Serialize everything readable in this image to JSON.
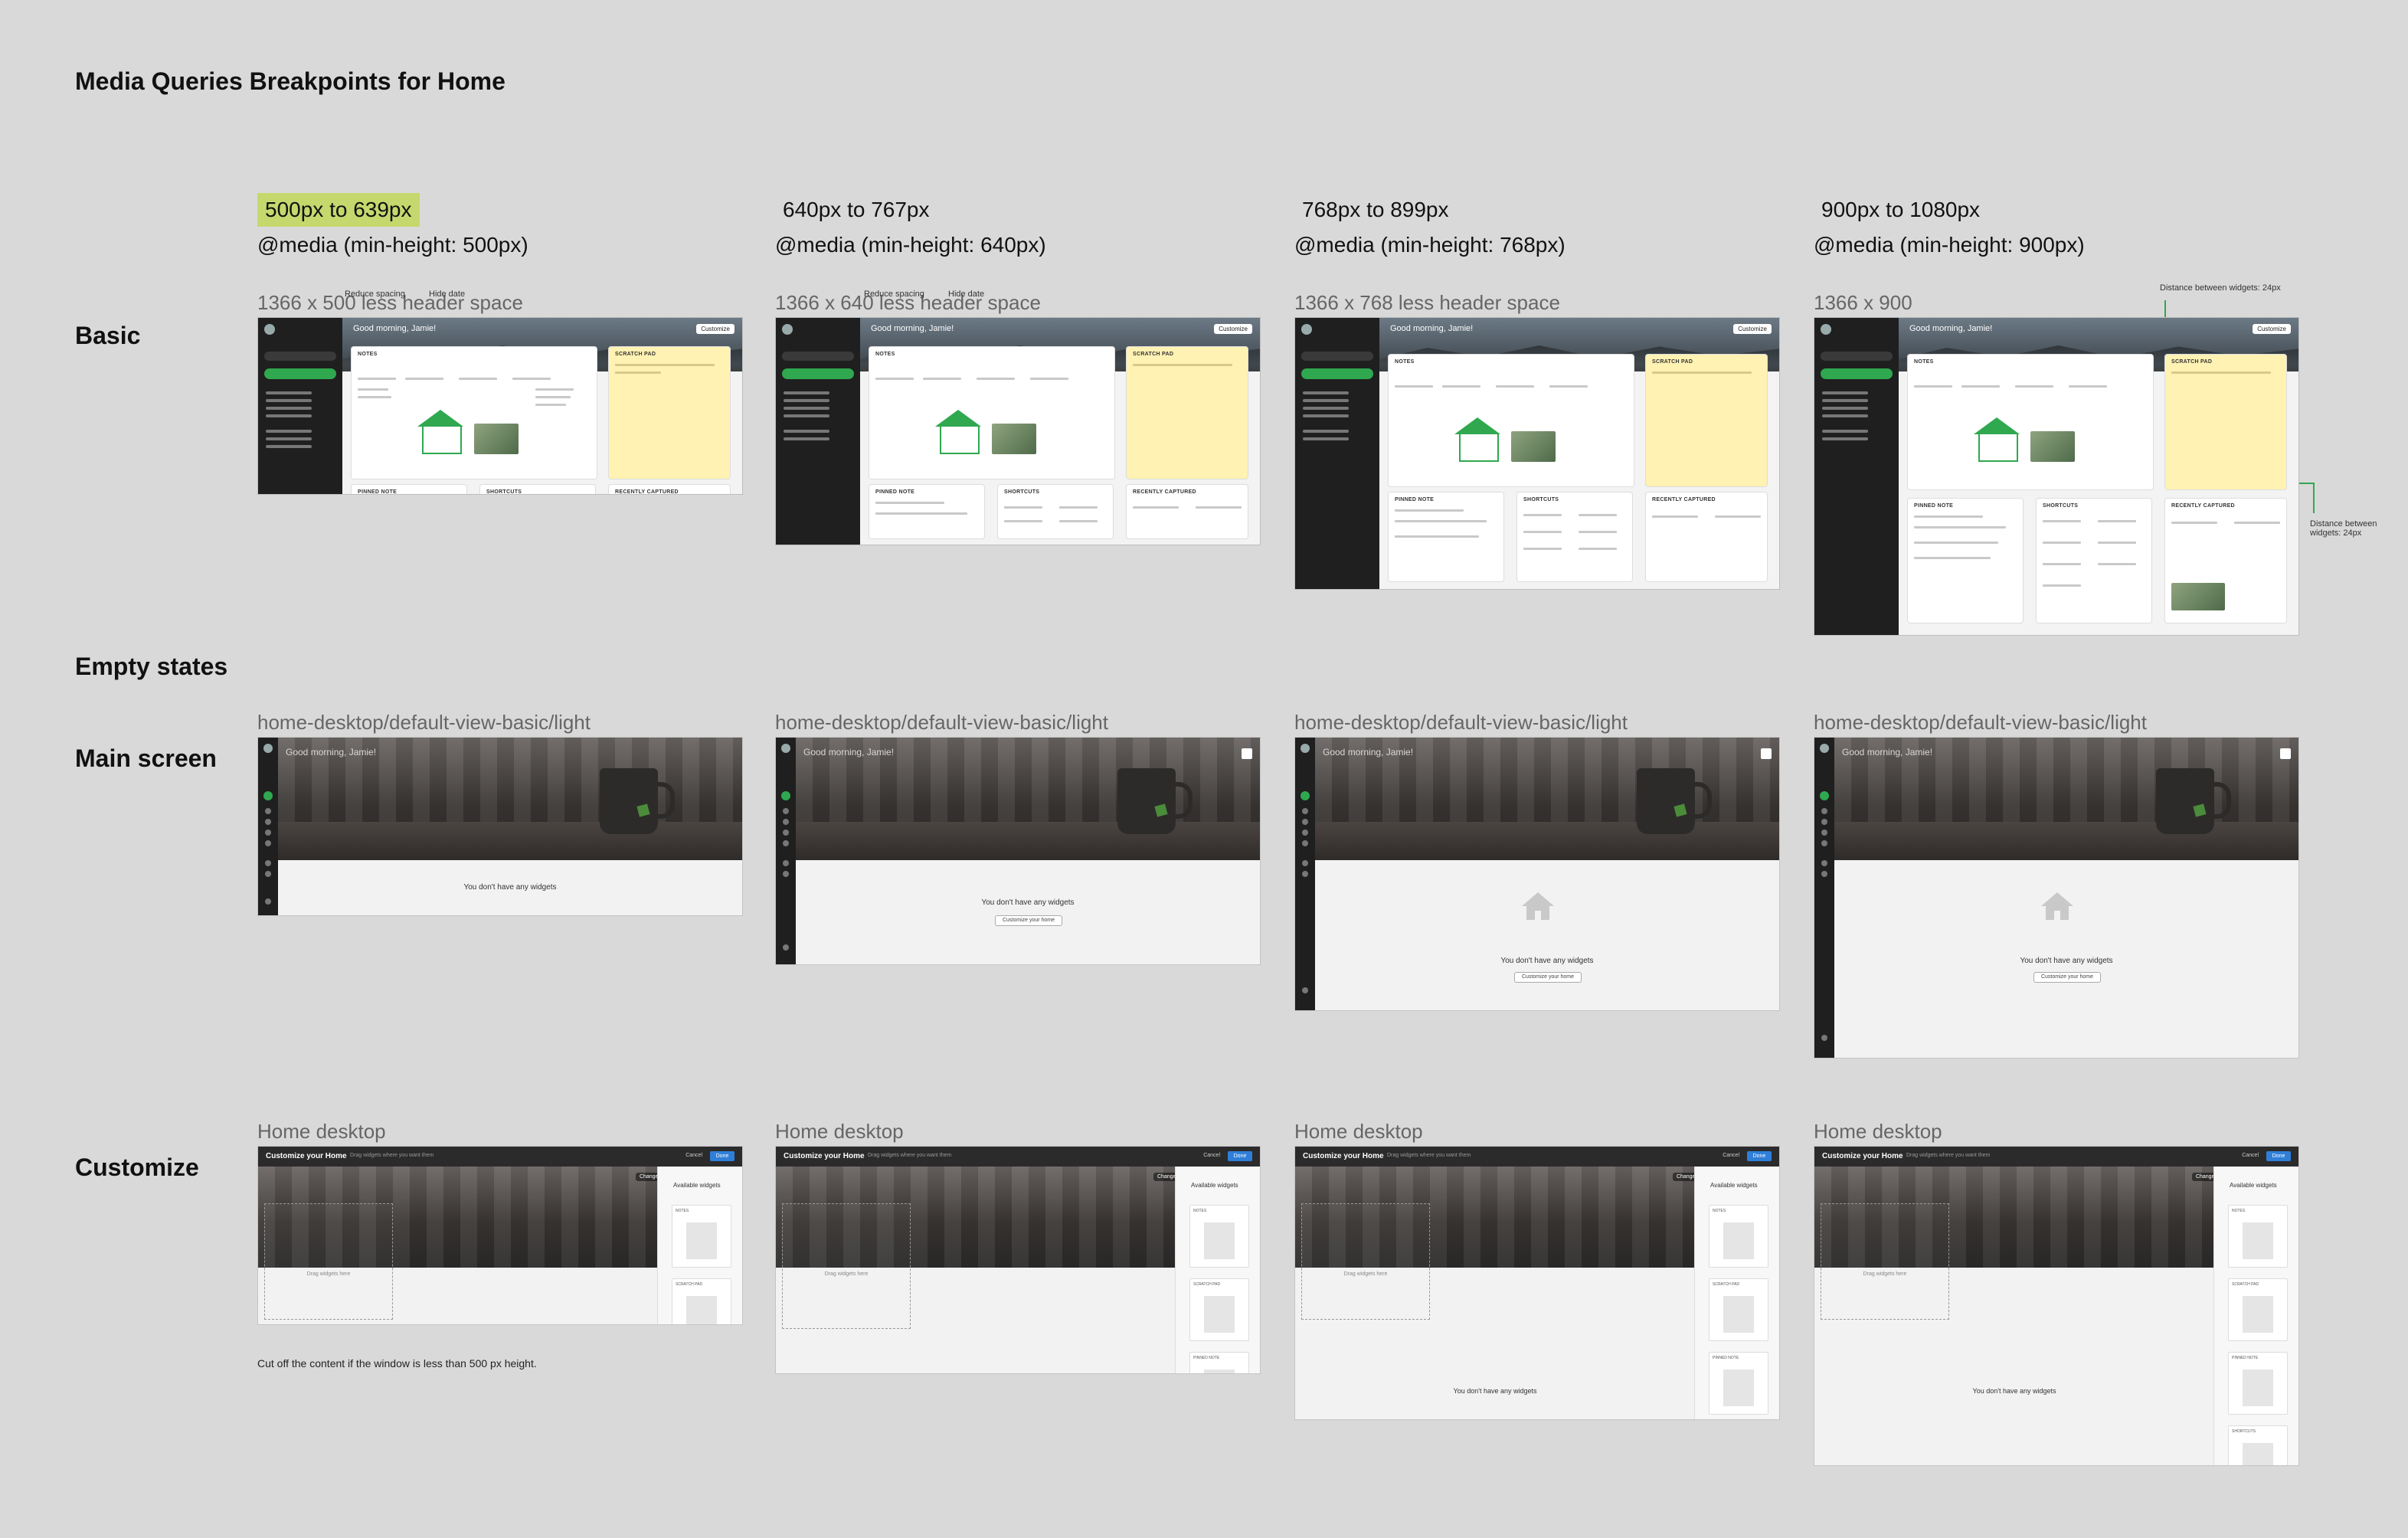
{
  "page_title": "Media Queries Breakpoints for Home",
  "row_labels": {
    "basic": "Basic",
    "empty_states": "Empty states",
    "main_screen": "Main screen",
    "customize": "Customize"
  },
  "columns": [
    {
      "range": "500px to 639px",
      "media": "@media (min-height: 500px)",
      "basic_caption": "1366 x 500 less header space",
      "empty_caption": "home-desktop/default-view-basic/light",
      "customize_caption": "Home desktop"
    },
    {
      "range": "640px to 767px",
      "media": "@media (min-height: 640px)",
      "basic_caption": "1366 x 640 less header space",
      "empty_caption": "home-desktop/default-view-basic/light",
      "customize_caption": "Home desktop"
    },
    {
      "range": "768px to 899px",
      "media": "@media (min-height: 768px)",
      "basic_caption": "1366 x 768 less header space",
      "empty_caption": "home-desktop/default-view-basic/light",
      "customize_caption": "Home desktop"
    },
    {
      "range": "900px to 1080px",
      "media": "@media (min-height: 900px)",
      "basic_caption": "1366 x 900",
      "empty_caption": "home-desktop/default-view-basic/light",
      "customize_caption": "Home desktop"
    }
  ],
  "annotations": {
    "reduce_spacing": "Reduce spacing",
    "hide_date": "Hide date",
    "distance_top": "Distance between widgets: 24px",
    "distance_side": "Distance between widgets: 24px"
  },
  "mock": {
    "greeting": "Good morning, Jamie!",
    "customize": "Customize",
    "notes": "NOTES",
    "scratch_pad": "SCRATCH PAD",
    "pinned_note": "PINNED NOTE",
    "shortcuts": "SHORTCUTS",
    "recently_captured": "RECENTLY CAPTURED",
    "empty_message": "You don't have any widgets",
    "customize_btn": "Customize your home"
  },
  "customize": {
    "title": "Customize your Home",
    "hint": "Drag widgets where you want them",
    "cancel": "Cancel",
    "done": "Done",
    "change_bg": "Change background",
    "available": "Available widgets",
    "drag_here": "Drag widgets here",
    "tile_notes": "NOTES",
    "tile_scratch": "SCRATCH PAD",
    "tile_pinned": "PINNED NOTE",
    "tile_shortcuts": "SHORTCUTS",
    "empty": "You don't have any widgets"
  },
  "footnote": "Cut off the content if the window is less than 500 px height.",
  "colors": {
    "highlight": "#c5d86d",
    "accent_green": "#2fa84f",
    "sidebar": "#1f1f1f",
    "done_blue": "#2f7fd9"
  }
}
